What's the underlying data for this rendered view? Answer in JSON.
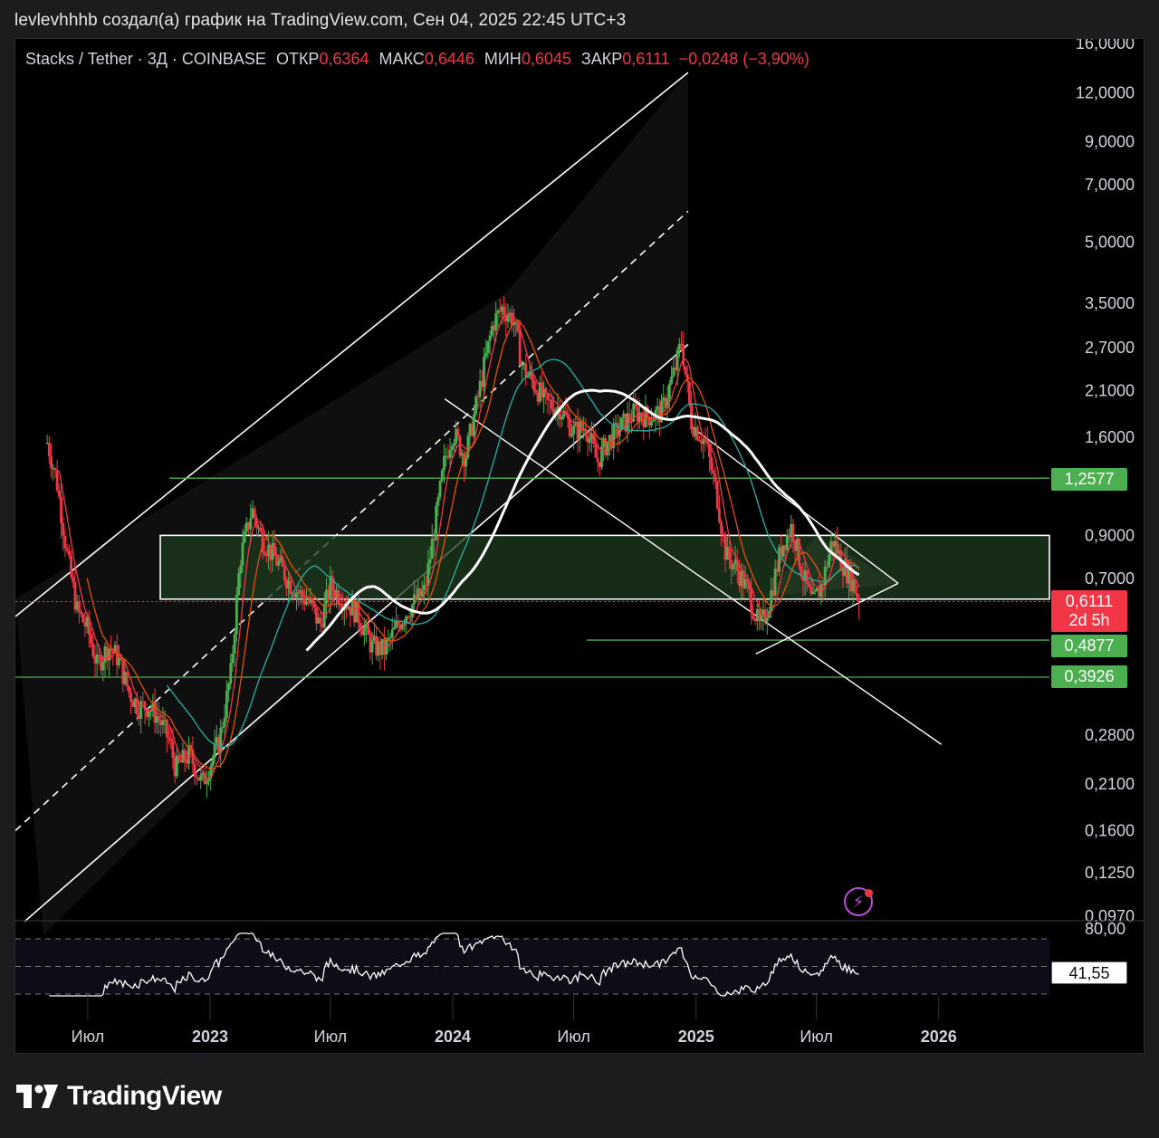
{
  "header": {
    "caption": "levlevhhhb создал(а) график на TradingView.com, Сен 04, 2025 22:45 UTC+3"
  },
  "legend": {
    "symbol": "Stacks / Tether · 3Д · COINBASE",
    "open_label": "ОТКР",
    "open_value": "0,6364",
    "high_label": "МАКС",
    "high_value": "0,6446",
    "low_label": "МИН",
    "low_value": "0,6045",
    "close_label": "ЗАКР",
    "close_value": "0,6111",
    "change": "−0,0248 (−3,90%)"
  },
  "price_tags": {
    "level_1": "1,2577",
    "last": "0,6111",
    "countdown": "2d 5h",
    "level_2": "0,4877",
    "level_3": "0,3926",
    "rsi": "41,55"
  },
  "colors": {
    "background": "#000000",
    "up_candle": "#4caf50",
    "down_candle": "#f23645",
    "ma_fast": "#f23645",
    "ma_mid": "#e65100",
    "ma_teal": "#26a69a",
    "ma_slow": "#ffffff",
    "zone_fill": "#1e3b1e",
    "level_line": "#4caf50",
    "accent_purple": "#b84fd6"
  },
  "branding": {
    "logo_text": "TradingView"
  },
  "chart_data": {
    "type": "candlestick",
    "symbol": "STXUSDT",
    "interval": "3D",
    "y_scale": "log",
    "y_ticks": [
      {
        "value": 16.0,
        "label": "16,0000"
      },
      {
        "value": 12.0,
        "label": "12,0000"
      },
      {
        "value": 9.0,
        "label": "9,0000"
      },
      {
        "value": 7.0,
        "label": "7,0000"
      },
      {
        "value": 5.0,
        "label": "5,0000"
      },
      {
        "value": 3.5,
        "label": "3,5000"
      },
      {
        "value": 2.7,
        "label": "2,7000"
      },
      {
        "value": 2.1,
        "label": "2,1000"
      },
      {
        "value": 1.6,
        "label": "1,6000"
      },
      {
        "value": 0.9,
        "label": "0,9000"
      },
      {
        "value": 0.7,
        "label": "0,7000"
      },
      {
        "value": 0.28,
        "label": "0,2800"
      },
      {
        "value": 0.21,
        "label": "0,2100"
      },
      {
        "value": 0.16,
        "label": "0,1600"
      },
      {
        "value": 0.125,
        "label": "0,1250"
      },
      {
        "value": 0.097,
        "label": "0,0970"
      }
    ],
    "x_ticks": [
      {
        "date": "2022-07-01",
        "label": "Июл",
        "bold": false
      },
      {
        "date": "2023-01-01",
        "label": "2023",
        "bold": true
      },
      {
        "date": "2023-07-01",
        "label": "Июл",
        "bold": false
      },
      {
        "date": "2024-01-01",
        "label": "2024",
        "bold": true
      },
      {
        "date": "2024-07-01",
        "label": "Июл",
        "bold": false
      },
      {
        "date": "2025-01-01",
        "label": "2025",
        "bold": true
      },
      {
        "date": "2025-07-01",
        "label": "Июл",
        "bold": false
      },
      {
        "date": "2026-01-01",
        "label": "2026",
        "bold": true
      }
    ],
    "price_path": [
      [
        "2022-05-01",
        1.55
      ],
      [
        "2022-05-15",
        1.25
      ],
      [
        "2022-06-01",
        0.78
      ],
      [
        "2022-06-15",
        0.58
      ],
      [
        "2022-07-01",
        0.52
      ],
      [
        "2022-07-15",
        0.42
      ],
      [
        "2022-08-01",
        0.47
      ],
      [
        "2022-08-15",
        0.44
      ],
      [
        "2022-09-01",
        0.36
      ],
      [
        "2022-09-15",
        0.33
      ],
      [
        "2022-10-01",
        0.33
      ],
      [
        "2022-10-15",
        0.31
      ],
      [
        "2022-11-01",
        0.27
      ],
      [
        "2022-11-10",
        0.23
      ],
      [
        "2022-12-01",
        0.25
      ],
      [
        "2022-12-20",
        0.21
      ],
      [
        "2023-01-15",
        0.27
      ],
      [
        "2023-02-01",
        0.4
      ],
      [
        "2023-02-15",
        0.78
      ],
      [
        "2023-03-05",
        1.05
      ],
      [
        "2023-03-20",
        0.88
      ],
      [
        "2023-04-10",
        0.78
      ],
      [
        "2023-05-01",
        0.68
      ],
      [
        "2023-06-01",
        0.6
      ],
      [
        "2023-06-15",
        0.53
      ],
      [
        "2023-07-01",
        0.67
      ],
      [
        "2023-07-20",
        0.62
      ],
      [
        "2023-08-10",
        0.57
      ],
      [
        "2023-09-01",
        0.47
      ],
      [
        "2023-09-20",
        0.46
      ],
      [
        "2023-10-15",
        0.55
      ],
      [
        "2023-11-01",
        0.6
      ],
      [
        "2023-11-20",
        0.65
      ],
      [
        "2023-12-05",
        0.95
      ],
      [
        "2023-12-20",
        1.4
      ],
      [
        "2024-01-01",
        1.65
      ],
      [
        "2024-01-20",
        1.42
      ],
      [
        "2024-02-10",
        2.1
      ],
      [
        "2024-03-01",
        3.1
      ],
      [
        "2024-03-15",
        3.4
      ],
      [
        "2024-04-01",
        3.2
      ],
      [
        "2024-04-15",
        2.4
      ],
      [
        "2024-05-01",
        2.2
      ],
      [
        "2024-05-20",
        1.95
      ],
      [
        "2024-06-10",
        1.9
      ],
      [
        "2024-07-01",
        1.65
      ],
      [
        "2024-07-20",
        1.7
      ],
      [
        "2024-08-05",
        1.38
      ],
      [
        "2024-08-20",
        1.55
      ],
      [
        "2024-09-10",
        1.7
      ],
      [
        "2024-10-01",
        1.85
      ],
      [
        "2024-10-20",
        1.8
      ],
      [
        "2024-11-10",
        1.85
      ],
      [
        "2024-12-01",
        2.4
      ],
      [
        "2024-12-10",
        2.8
      ],
      [
        "2024-12-25",
        1.75
      ],
      [
        "2025-01-15",
        1.55
      ],
      [
        "2025-02-01",
        1.15
      ],
      [
        "2025-02-15",
        0.8
      ],
      [
        "2025-03-01",
        0.75
      ],
      [
        "2025-03-20",
        0.65
      ],
      [
        "2025-04-07",
        0.52
      ],
      [
        "2025-04-20",
        0.6
      ],
      [
        "2025-05-10",
        0.85
      ],
      [
        "2025-05-25",
        0.95
      ],
      [
        "2025-06-10",
        0.72
      ],
      [
        "2025-06-25",
        0.6
      ],
      [
        "2025-07-10",
        0.68
      ],
      [
        "2025-07-25",
        0.88
      ],
      [
        "2025-08-10",
        0.76
      ],
      [
        "2025-08-25",
        0.68
      ],
      [
        "2025-09-04",
        0.6111
      ]
    ],
    "levels": [
      1.2577,
      0.4877,
      0.3926
    ],
    "rsi": {
      "upper_label": "80,00",
      "last": 41.55
    }
  }
}
